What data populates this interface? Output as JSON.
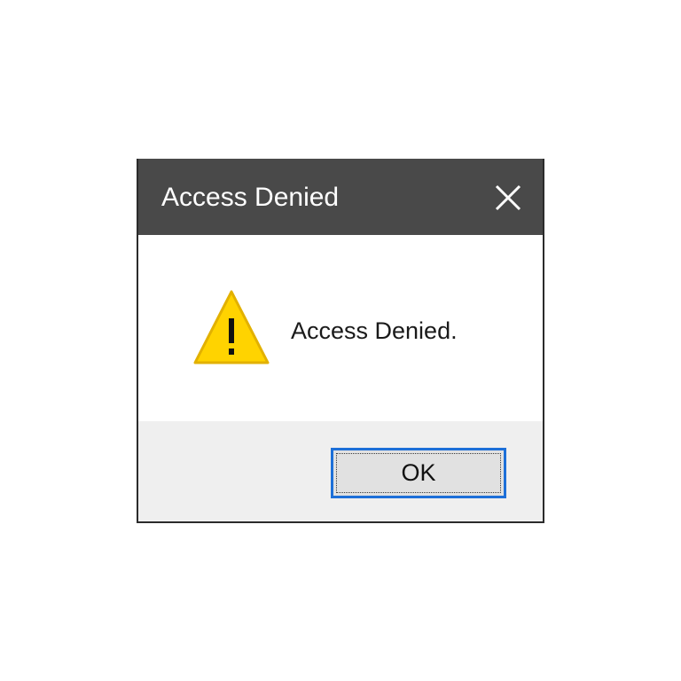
{
  "dialog": {
    "title": "Access Denied",
    "message": "Access Denied.",
    "ok_label": "OK",
    "icons": {
      "close": "close-icon",
      "status": "warning-icon"
    }
  },
  "colors": {
    "titlebar": "#494949",
    "title_text": "#ffffff",
    "warning_fill": "#ffd300",
    "button_focus": "#1d6fd8",
    "footer": "#efefef"
  }
}
